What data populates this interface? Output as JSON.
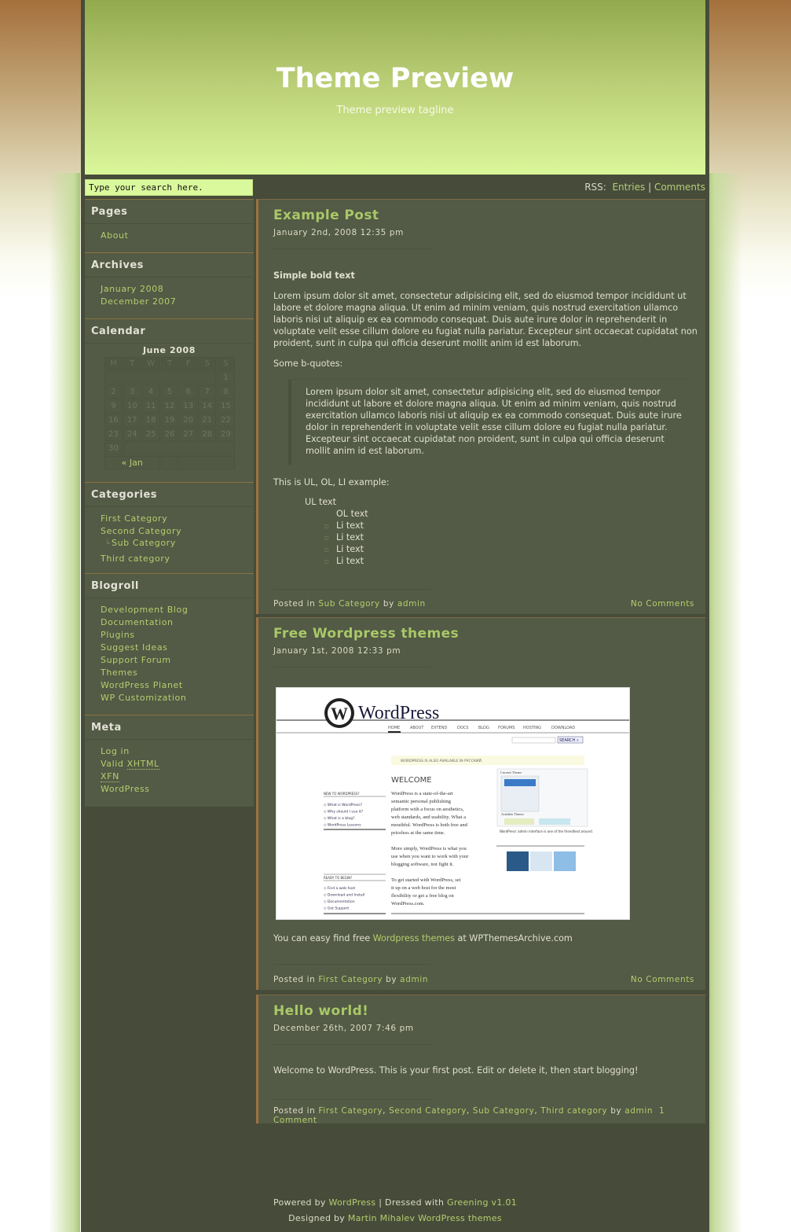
{
  "header": {
    "title": "Theme Preview",
    "tagline": "Theme preview tagline"
  },
  "search": {
    "placeholder": "Type your search here."
  },
  "rss": {
    "label": "RSS:",
    "entries": "Entries",
    "separator": "|",
    "comments": "Comments"
  },
  "sidebar": {
    "pages": {
      "title": "Pages",
      "items": [
        "About"
      ]
    },
    "archives": {
      "title": "Archives",
      "items": [
        "January 2008",
        "December 2007"
      ]
    },
    "calendar": {
      "title": "Calendar",
      "caption": "June 2008",
      "weekdays": [
        "M",
        "T",
        "W",
        "T",
        "F",
        "S",
        "S"
      ],
      "weeks": [
        [
          "",
          "",
          "",
          "",
          "",
          "",
          "1"
        ],
        [
          "2",
          "3",
          "4",
          "5",
          "6",
          "7",
          "8"
        ],
        [
          "9",
          "10",
          "11",
          "12",
          "13",
          "14",
          "15"
        ],
        [
          "16",
          "17",
          "18",
          "19",
          "20",
          "21",
          "22"
        ],
        [
          "23",
          "24",
          "25",
          "26",
          "27",
          "28",
          "29"
        ],
        [
          "30",
          "",
          "",
          "",
          "",
          "",
          ""
        ]
      ],
      "prev": "« Jan"
    },
    "categories": {
      "title": "Categories",
      "items": [
        "First Category",
        "Second Category",
        "Sub Category",
        "Third category"
      ]
    },
    "blogroll": {
      "title": "Blogroll",
      "items": [
        "Development Blog",
        "Documentation",
        "Plugins",
        "Suggest Ideas",
        "Support Forum",
        "Themes",
        "WordPress Planet",
        "WP Customization"
      ]
    },
    "meta": {
      "title": "Meta",
      "login": "Log in",
      "valid": "Valid",
      "xhtml": "XHTML",
      "xfn": "XFN",
      "wordpress": "WordPress"
    }
  },
  "posts": [
    {
      "title": "Example Post",
      "date": "January 2nd, 2008 12:35 pm",
      "bold": "Simple bold text",
      "para": "Lorem ipsum dolor sit amet, consectetur adipisicing elit, sed do eiusmod tempor incididunt ut labore et dolore magna aliqua. Ut enim ad minim veniam, quis nostrud exercitation ullamco laboris nisi ut aliquip ex ea commodo consequat. Duis aute irure dolor in reprehenderit in voluptate velit esse cillum dolore eu fugiat nulla pariatur. Excepteur sint occaecat cupidatat non proident, sunt in culpa qui officia deserunt mollit anim id est laborum.",
      "bquote_intro": "Some b-quotes:",
      "bquote": "Lorem ipsum dolor sit amet, consectetur adipisicing elit, sed do eiusmod tempor incididunt ut labore et dolore magna aliqua. Ut enim ad minim veniam, quis nostrud exercitation ullamco laboris nisi ut aliquip ex ea commodo consequat. Duis aute irure dolor in reprehenderit in voluptate velit esse cillum dolore eu fugiat nulla pariatur. Excepteur sint occaecat cupidatat non proident, sunt in culpa qui officia deserunt mollit anim id est laborum.",
      "list_intro": "This is UL, OL, LI example:",
      "ul_text": "UL text",
      "ol_text": "OL text",
      "li_items": [
        "Li text",
        "Li text",
        "Li text",
        "Li text"
      ],
      "meta": {
        "posted_in": "Posted in",
        "categories": [
          "Sub Category"
        ],
        "by": "by",
        "author": "admin",
        "comments": "No Comments"
      }
    },
    {
      "title": "Free Wordpress themes",
      "date": "January 1st, 2008 12:33 pm",
      "image_alt": "WordPress.org homepage screenshot",
      "shot": {
        "logo": "WordPress",
        "nav": [
          "HOME",
          "ABOUT",
          "EXTEND",
          "DOCS",
          "BLOG",
          "FORUMS",
          "HOSTING",
          "DOWNLOAD"
        ],
        "search_btn": "SEARCH »",
        "notice": "WORDPRESS IS ALSO AVAILABLE IN РУССКИЙ.",
        "welcome": "WELCOME",
        "intro_bold": "WordPress is",
        "intro": "a state-of-the-art semantic personal publishing platform with a focus on aesthetics, web standards, and usability. What a mouthful. WordPress is both free and priceless at the same time.",
        "p2": "More simply, WordPress is what you use when you want to work with your blogging software, not fight it.",
        "p3a": "To get started with WordPress,",
        "p3b": "set it up on a web host",
        "p3c": "for the most flexibility or",
        "p3d": "get a free blog on WordPress.com",
        "new_title": "NEW TO WORDPRESS?",
        "new_items": [
          "What is WordPress?",
          "Why should I use it?",
          "What is a blog?",
          "WordPress Lessons"
        ],
        "ready_title": "READY TO BEGIN?",
        "ready_items": [
          "Find a web host",
          "Download and Install",
          "Documentation",
          "Get Support"
        ],
        "current_theme": "Current Theme",
        "available_themes": "Available Themes",
        "admin_caption": "WordPress' admin interface is one of the friendliest around."
      },
      "text_before": "You can easy find free",
      "link": "Wordpress themes",
      "text_after": "at WPThemesArchive.com",
      "meta": {
        "posted_in": "Posted in",
        "categories": [
          "First Category"
        ],
        "by": "by",
        "author": "admin",
        "comments": "No Comments"
      }
    },
    {
      "title": "Hello world!",
      "date": "December 26th, 2007 7:46 pm",
      "para": "Welcome to WordPress. This is your first post. Edit or delete it, then start blogging!",
      "meta": {
        "posted_in": "Posted in",
        "categories": [
          "First Category",
          "Second Category",
          "Sub Category",
          "Third category"
        ],
        "by": "by",
        "author": "admin",
        "comments": "1 Comment"
      }
    }
  ],
  "footer": {
    "powered_by": "Powered by",
    "wordpress": "WordPress",
    "sep": "|",
    "dressed": "Dressed with",
    "theme": "Greening v1.01",
    "designed_by": "Designed by",
    "designer": "Martin Mihalev WordPress themes"
  }
}
